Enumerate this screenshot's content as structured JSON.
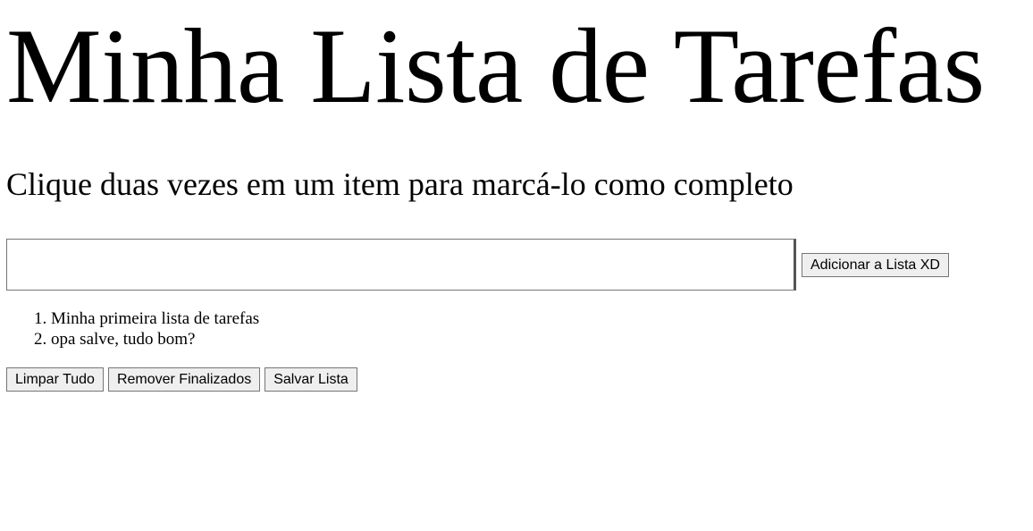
{
  "header": {
    "title": "Minha Lista de Tarefas",
    "subtitle": "Clique duas vezes em um item para marcá-lo como completo"
  },
  "form": {
    "input_value": "",
    "add_button_label": "Adicionar a Lista XD"
  },
  "tasks": [
    {
      "text": "Minha primeira lista de tarefas"
    },
    {
      "text": "opa salve, tudo bom?"
    }
  ],
  "actions": {
    "clear_all_label": "Limpar Tudo",
    "remove_done_label": "Remover Finalizados",
    "save_list_label": "Salvar Lista"
  }
}
